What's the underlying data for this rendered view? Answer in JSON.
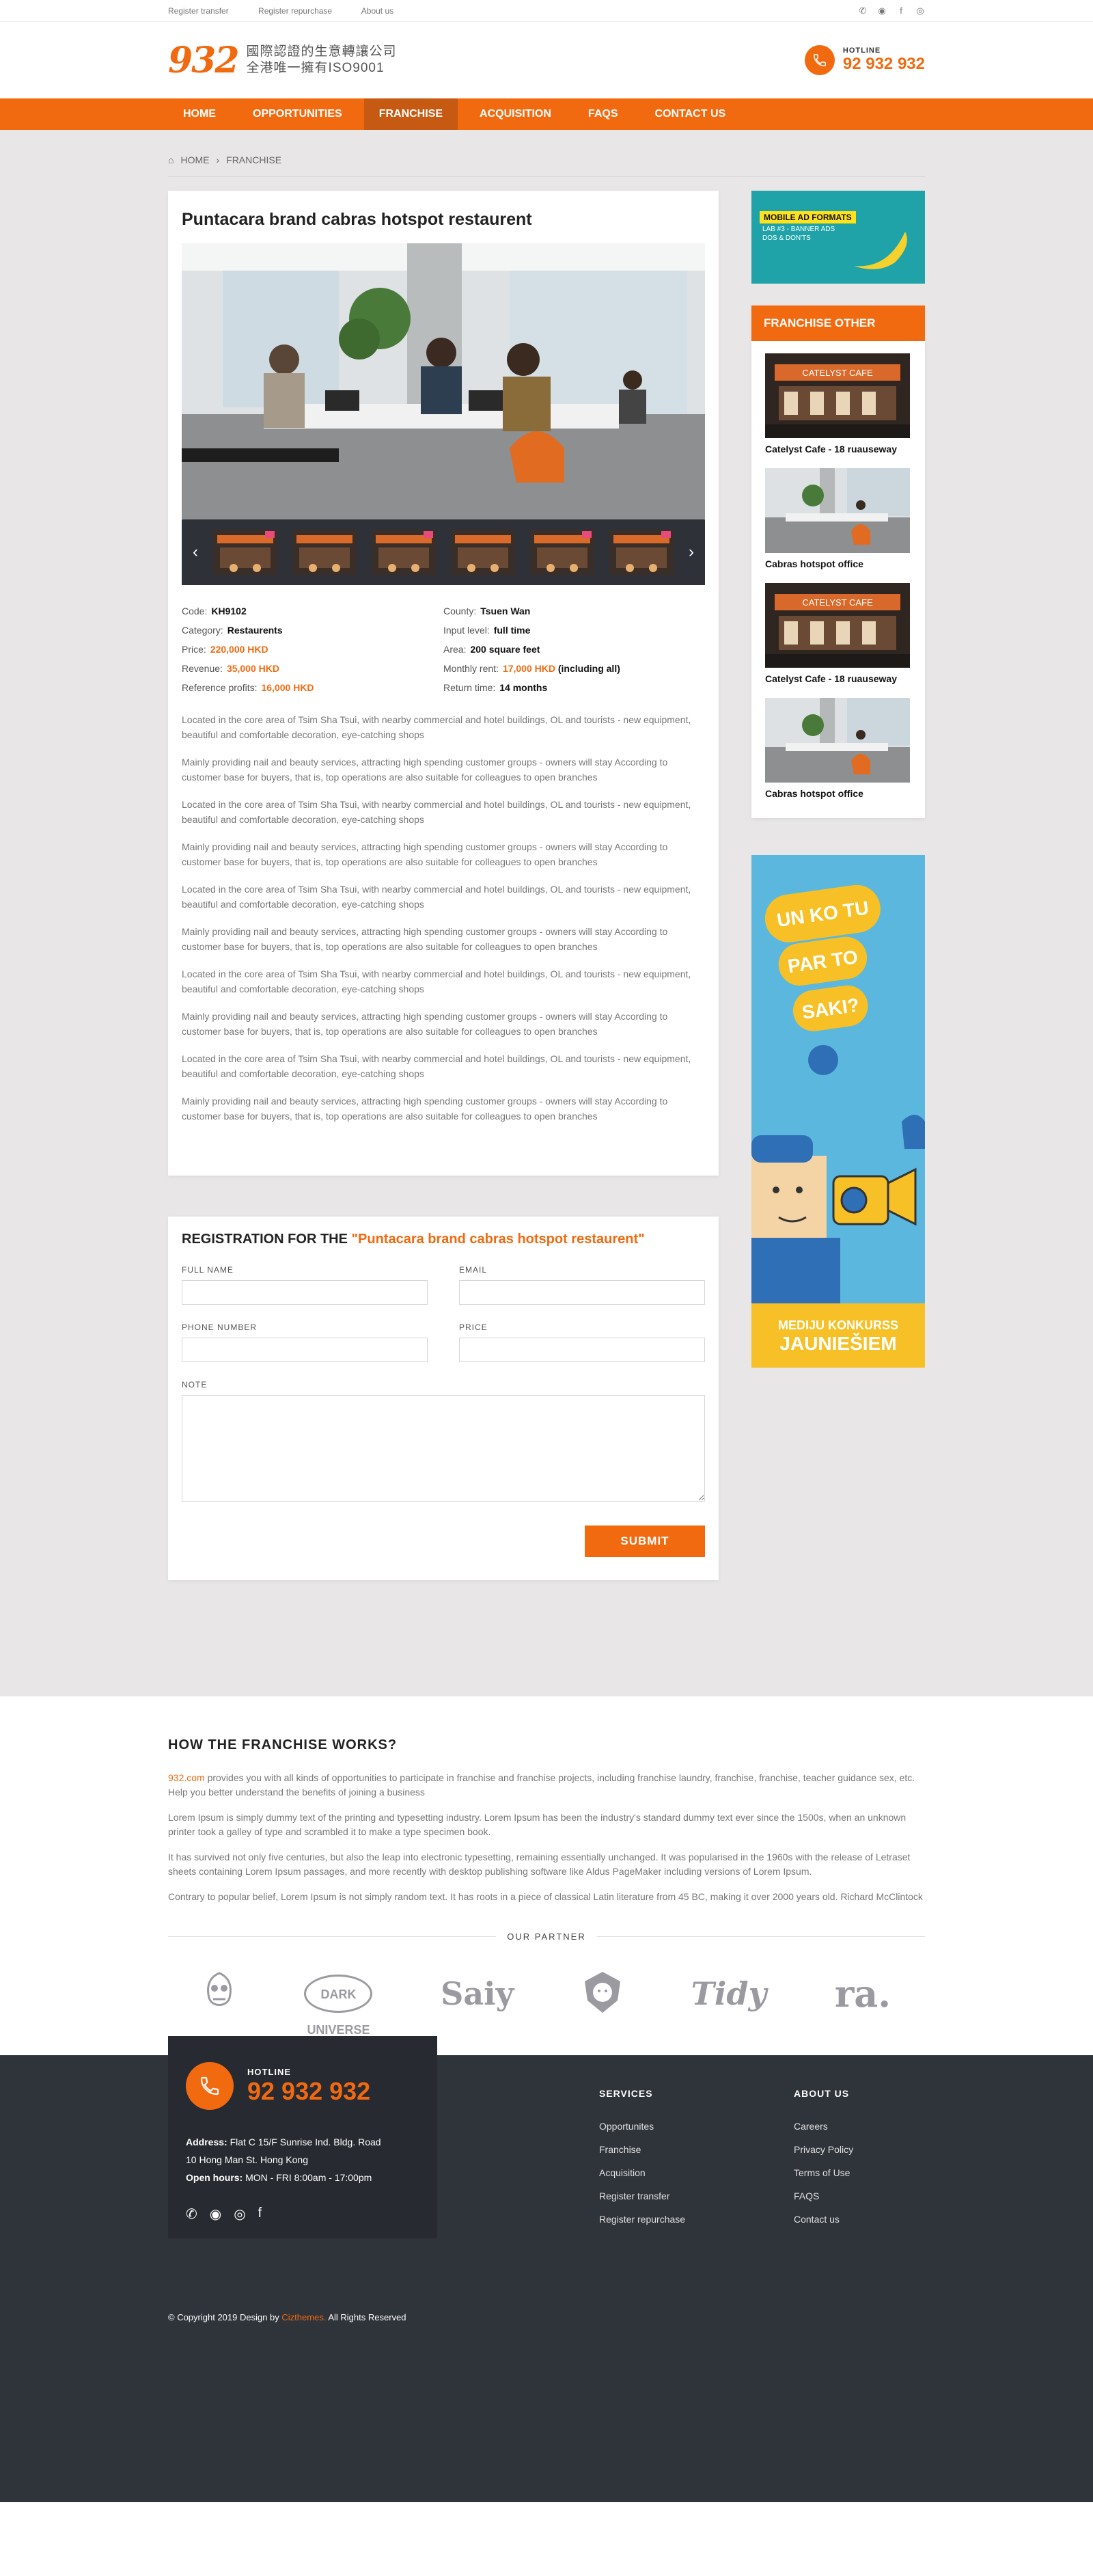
{
  "topbar": {
    "links": [
      "Register transfer",
      "Register repurchase",
      "About us"
    ],
    "social_icons": [
      "whatsapp-icon",
      "weibo-icon",
      "facebook-icon",
      "instagram-icon"
    ]
  },
  "header": {
    "logo_number": "932",
    "logo_line1": "國際認證的生意轉讓公司",
    "logo_line2": "全港唯一擁有ISO9001",
    "hotline_label": "HOTLINE",
    "hotline_number": "92 932 932"
  },
  "nav": {
    "items": [
      "HOME",
      "OPPORTUNITIES",
      "FRANCHISE",
      "ACQUISITION",
      "FAQS",
      "CONTACT US"
    ],
    "active": "FRANCHISE"
  },
  "breadcrumb": {
    "home": "HOME",
    "current": "FRANCHISE"
  },
  "listing": {
    "title": "Puntacara brand cabras hotspot restaurent",
    "specs": [
      {
        "key": "Code:",
        "value": "KH9102",
        "highlight": false
      },
      {
        "key": "County:",
        "value": "Tsuen Wan",
        "highlight": false
      },
      {
        "key": "Category:",
        "value": "Restaurents",
        "highlight": false
      },
      {
        "key": "Input level:",
        "value": "full time",
        "highlight": false
      },
      {
        "key": "Price:",
        "value": "220,000 HKD",
        "highlight": true
      },
      {
        "key": "Area:",
        "value": "200 square feet",
        "highlight": false
      },
      {
        "key": "Revenue:",
        "value": "35,000 HKD",
        "highlight": true
      },
      {
        "key": "Monthly rent:",
        "value": "17,000 HKD",
        "highlight": true,
        "suffix": "(including all)"
      },
      {
        "key": "Reference profits:",
        "value": "16,000 HKD",
        "highlight": true
      },
      {
        "key": "Return time:",
        "value": "14 months",
        "highlight": false
      }
    ],
    "paragraphs": [
      "Located in the core area of Tsim Sha Tsui, with nearby commercial and hotel buildings, OL and tourists - new equipment, beautiful and comfortable decoration, eye-catching shops",
      "Mainly providing nail and beauty services, attracting high spending customer groups - owners will stay According to customer base for buyers, that is, top operations are also suitable for colleagues to open branches",
      "Located in the core area of Tsim Sha Tsui, with nearby commercial and hotel buildings, OL and tourists - new equipment, beautiful and comfortable decoration, eye-catching shops",
      "Mainly providing nail and beauty services, attracting high spending customer groups - owners will stay According to customer base for buyers, that is, top operations are also suitable for colleagues to open branches",
      "Located in the core area of Tsim Sha Tsui, with nearby commercial and hotel buildings, OL and tourists - new equipment, beautiful and comfortable decoration, eye-catching shops",
      "Mainly providing nail and beauty services, attracting high spending customer groups - owners will stay According to customer base for buyers, that is, top operations are also suitable for colleagues to open branches",
      "Located in the core area of Tsim Sha Tsui, with nearby commercial and hotel buildings, OL and tourists - new equipment, beautiful and comfortable decoration, eye-catching shops",
      "Mainly providing nail and beauty services, attracting high spending customer groups - owners will stay According to customer base for buyers, that is, top operations are also suitable for colleagues to open branches",
      "Located in the core area of Tsim Sha Tsui, with nearby commercial and hotel buildings, OL and tourists - new equipment, beautiful and comfortable decoration, eye-catching shops",
      "Mainly providing nail and beauty services, attracting high spending customer groups - owners will stay According to customer base for buyers, that is, top operations are also suitable for colleagues to open branches"
    ]
  },
  "registration": {
    "title_prefix": "REGISTRATION FOR THE",
    "title_highlight": "\"Puntacara brand cabras hotspot restaurent\"",
    "full_name_label": "FULL NAME",
    "email_label": "EMAIL",
    "phone_label": "PHONE NUMBER",
    "price_label": "PRICE",
    "note_label": "NOTE",
    "submit_label": "SUBMIT"
  },
  "sidebar": {
    "ad1": {
      "tag": "MOBILE AD FORMATS",
      "line1": "LAB #3 - BANNER ADS",
      "line2": "DOS & DON'TS"
    },
    "franchise_other_title": "FRANCHISE OTHER",
    "catelyst_sign": "CATELYST CAFE",
    "items": [
      {
        "name": "Catelyst Cafe - 18 ruauseway",
        "kind": "cafe"
      },
      {
        "name": "Cabras hotspot office",
        "kind": "office"
      },
      {
        "name": "Catelyst Cafe - 18 ruauseway",
        "kind": "cafe"
      },
      {
        "name": "Cabras hotspot office",
        "kind": "office"
      }
    ],
    "ad2": {
      "bubble1": "UN KO TU",
      "bubble2": "PAR TO",
      "bubble3": "SAKI?",
      "bottom1": "MEDIJU KONKURSS",
      "bottom2": "JAUNIEŠIEM"
    }
  },
  "works": {
    "title": "HOW THE FRANCHISE WORKS?",
    "p1_link": "932.com",
    "p1_rest": " provides you with all kinds of opportunities to participate in franchise and franchise projects, including franchise laundry, franchise, franchise, teacher guidance sex, etc. Help you better understand the benefits of joining a business",
    "p2": "Lorem Ipsum is simply dummy text of the printing and typesetting industry. Lorem Ipsum has been the industry's standard dummy text ever since the 1500s, when an unknown printer took a galley of type and scrambled it to make a type specimen book.",
    "p3": "It has survived not only five centuries, but also the leap into electronic typesetting, remaining essentially unchanged. It was popularised in the 1960s with the release of Letraset sheets containing Lorem Ipsum passages, and more recently with desktop publishing software like Aldus PageMaker including versions of Lorem Ipsum.",
    "p4": "Contrary to popular belief, Lorem Ipsum is not simply random text. It has roots in a piece of classical Latin literature from 45 BC, making it over 2000 years old. Richard McClintock",
    "partner_label": "OUR PARTNER",
    "partners": [
      "owl-logo",
      "DARK UNIVERSE",
      "Saiy",
      "lion-logo",
      "Tidy",
      "ra."
    ]
  },
  "footer": {
    "hotline_label": "HOTLINE",
    "hotline_number": "92 932 932",
    "address_label": "Address:",
    "address_value": "Flat C 15/F Sunrise Ind. Bldg.  Road",
    "address_line2": "10 Hong Man St. Hong Kong",
    "hours_label": "Open hours:",
    "hours_value": "MON - FRI  8:00am - 17:00pm",
    "services_title": "SERVICES",
    "services": [
      "Opportunites",
      "Franchise",
      "Acquisition",
      "Register transfer",
      "Register repurchase"
    ],
    "about_title": "ABOUT US",
    "about": [
      "Careers",
      "Privacy Policy",
      "Terms of Use",
      "FAQS",
      "Contact us"
    ],
    "copyright_prefix": "© Copyright 2019 Design by",
    "copyright_brand": "Cizthemes.",
    "copyright_suffix": "All Rights Reserved"
  },
  "colors": {
    "accent": "#f26a10",
    "footer_bg": "#2f333a",
    "main_bg": "#e8e6e6"
  }
}
